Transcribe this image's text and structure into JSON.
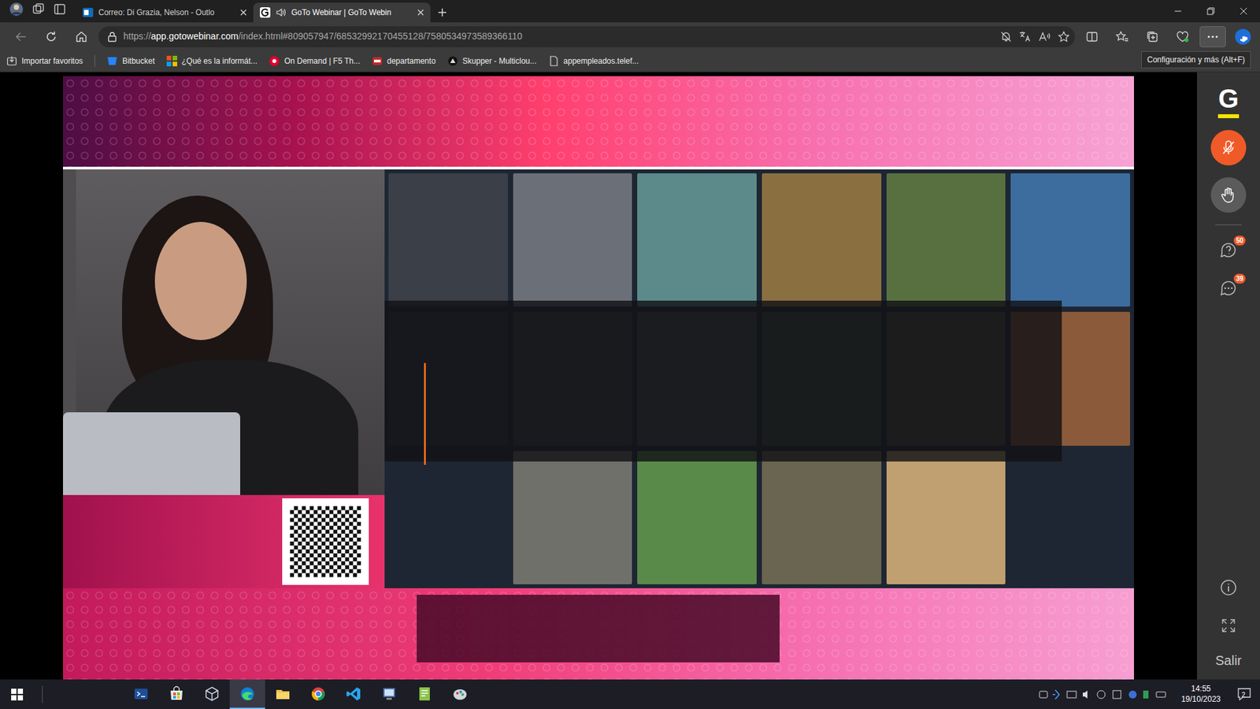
{
  "tabs": [
    {
      "label": "Correo: Di Grazia, Nelson - Outlo",
      "selected": false,
      "audio": false
    },
    {
      "label": "GoTo Webinar | GoTo Webin",
      "selected": true,
      "audio": true
    }
  ],
  "address_bar": {
    "scheme": "https://",
    "host": "app.gotowebinar.com",
    "path": "/index.html#809057947/68532992170455128/7580534973589366110"
  },
  "more_button": {
    "hovered": true
  },
  "bookmarks": [
    {
      "label": "Importar favoritos"
    },
    {
      "label": "Bitbucket"
    },
    {
      "label": "¿Qué es la informát..."
    },
    {
      "label": "On Demand | F5 Th..."
    },
    {
      "label": "departamento"
    },
    {
      "label": "Skupper - Multiclou..."
    },
    {
      "label": "appempleados.telef..."
    }
  ],
  "tooltip": "Configuración y más (Alt+F)",
  "webinar": {
    "logo": "G",
    "mic_muted": true,
    "questions_badge": "50",
    "chat_badge": "39",
    "exit": "Salir"
  },
  "taskbar": {
    "apps": [
      {
        "selected": false
      },
      {
        "selected": false
      },
      {
        "selected": false
      },
      {
        "selected": true
      },
      {
        "selected": false
      },
      {
        "selected": false
      },
      {
        "selected": false
      },
      {
        "selected": false
      },
      {
        "selected": false
      },
      {
        "selected": false
      }
    ],
    "time": "14:55",
    "date": "19/10/2023",
    "notifications": "2"
  }
}
